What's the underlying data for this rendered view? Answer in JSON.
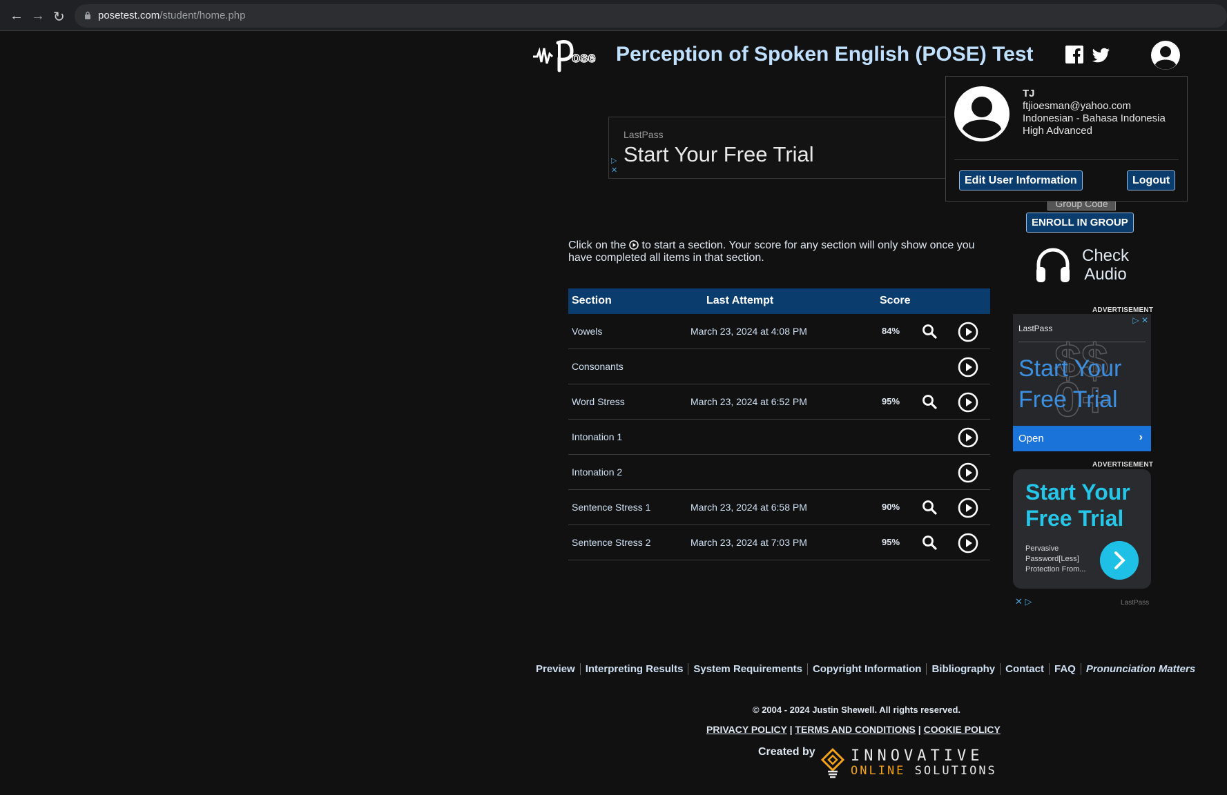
{
  "browser": {
    "url_host": "posetest.com",
    "url_path": "/student/home.php"
  },
  "header": {
    "title": "Perception of Spoken English (POSE) Test"
  },
  "user_menu": {
    "name": "TJ",
    "email": "ftjioesman@yahoo.com",
    "language": "Indonesian - Bahasa Indonesia",
    "level": "High Advanced",
    "edit_label": "Edit User Information",
    "logout_label": "Logout"
  },
  "ad_top": {
    "brand": "LastPass",
    "headline": "Start Your Free Trial"
  },
  "sidebar": {
    "group_code_placeholder": "Group Code",
    "enroll_label": "ENROLL IN GROUP",
    "check_audio_line1": "Check",
    "check_audio_line2": "Audio",
    "ad_label": "ADVERTISEMENT",
    "ad1": {
      "brand": "LastPass",
      "headline": "Start Your Free Trial",
      "open_label": "Open"
    },
    "ad2": {
      "headline": "Start Your Free Trial",
      "sub": "Pervasive Password[Less] Protection From...",
      "brand": "LastPass"
    }
  },
  "intro": {
    "before": "Click on the",
    "after": "to start a section. Your score for any section will only show once you have completed all items in that section."
  },
  "table": {
    "headers": {
      "section": "Section",
      "last_attempt": "Last Attempt",
      "score": "Score"
    },
    "rows": [
      {
        "section": "Vowels",
        "last_attempt": "March 23, 2024 at 4:08 PM",
        "score": "84%"
      },
      {
        "section": "Consonants",
        "last_attempt": "",
        "score": ""
      },
      {
        "section": "Word Stress",
        "last_attempt": "March 23, 2024 at 6:52 PM",
        "score": "95%"
      },
      {
        "section": "Intonation 1",
        "last_attempt": "",
        "score": ""
      },
      {
        "section": "Intonation 2",
        "last_attempt": "",
        "score": ""
      },
      {
        "section": "Sentence Stress 1",
        "last_attempt": "March 23, 2024 at 6:58 PM",
        "score": "90%"
      },
      {
        "section": "Sentence Stress 2",
        "last_attempt": "March 23, 2024 at 7:03 PM",
        "score": "95%"
      }
    ]
  },
  "footer": {
    "links": [
      "Preview",
      "Interpreting Results",
      "System Requirements",
      "Copyright Information",
      "Bibliography",
      "Contact",
      "FAQ",
      "Pronunciation Matters"
    ],
    "copyright": "© 2004 - 2024 Justin Shewell. All rights reserved.",
    "privacy": "PRIVACY POLICY",
    "terms": "TERMS AND CONDITIONS",
    "cookie": "COOKIE POLICY",
    "created_by": "Created by",
    "company_line1": "INNOVATIVE",
    "company_line2a": "ONLINE",
    "company_line2b": "SOLUTIONS"
  },
  "colors": {
    "background": "#111112",
    "accent_blue": "#0a3c6e",
    "title_blue": "#bfe0ff",
    "ad_cyan": "#26c6e8",
    "brand_orange": "#f3a21b"
  },
  "icons": [
    "back-arrow-icon",
    "forward-arrow-icon",
    "reload-icon",
    "lock-icon",
    "facebook-icon",
    "twitter-icon",
    "user-avatar-icon",
    "headphones-icon",
    "magnifier-icon",
    "play-circle-icon"
  ]
}
